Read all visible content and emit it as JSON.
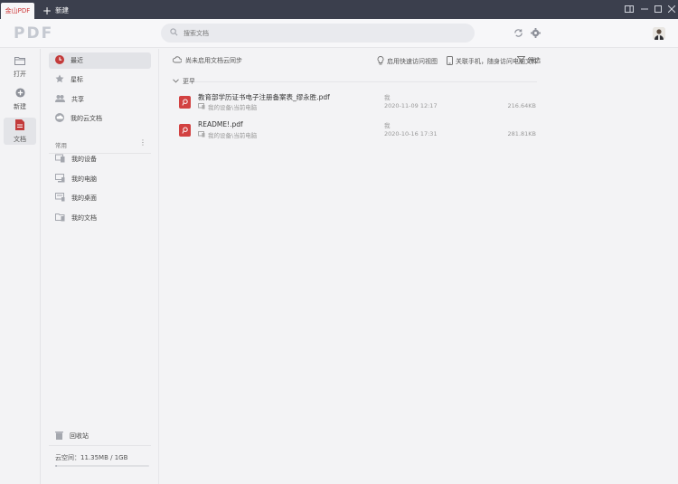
{
  "titlebar": {
    "active_tab": "金山PDF",
    "new_tab_label": "新建",
    "new_tab_icon": "plus-icon"
  },
  "header": {
    "logo_text": "PDF",
    "search_placeholder": "搜索文档"
  },
  "leftnav": {
    "items": [
      {
        "label": "打开",
        "icon": "folder-icon"
      },
      {
        "label": "新建",
        "icon": "plus-circle-icon"
      },
      {
        "label": "文档",
        "icon": "document-icon",
        "active": true
      }
    ]
  },
  "sidebar": {
    "items": [
      {
        "label": "最近",
        "icon": "clock-icon",
        "active": true
      },
      {
        "label": "星标",
        "icon": "star-icon"
      },
      {
        "label": "共享",
        "icon": "people-icon"
      },
      {
        "label": "我的云文档",
        "icon": "cloud-doc-icon"
      }
    ],
    "section_label": "常用",
    "common_items": [
      {
        "label": "我的设备",
        "icon": "device-icon"
      },
      {
        "label": "我的电脑",
        "icon": "computer-icon"
      },
      {
        "label": "我的桌面",
        "icon": "desktop-icon"
      },
      {
        "label": "我的文档",
        "icon": "folder-doc-icon"
      }
    ],
    "recycle_label": "回收站",
    "quota_label": "云空间：11.35MB / 1GB",
    "quota_fraction": 0.011
  },
  "toolbar": {
    "sync_label": "尚未启用文档云同步",
    "quick_access_label": "启用快速访问视图",
    "phone_label": "关联手机，随身访问电脑文件",
    "filter_label": "筛选"
  },
  "group": {
    "label": "更早"
  },
  "files": [
    {
      "name": "教育部学历证书电子注册备案表_缪永胜.pdf",
      "location": "我的设备\\当前电脑",
      "owner": "我",
      "time": "2020-11-09 12:17",
      "size": "216.64KB"
    },
    {
      "name": "README!.pdf",
      "location": "我的设备\\当前电脑",
      "owner": "我",
      "time": "2020-10-16 17:31",
      "size": "281.81KB"
    }
  ],
  "colors": {
    "accent": "#c33b3b",
    "titlebar": "#3b3f4d",
    "pdf_icon": "#d24141"
  }
}
